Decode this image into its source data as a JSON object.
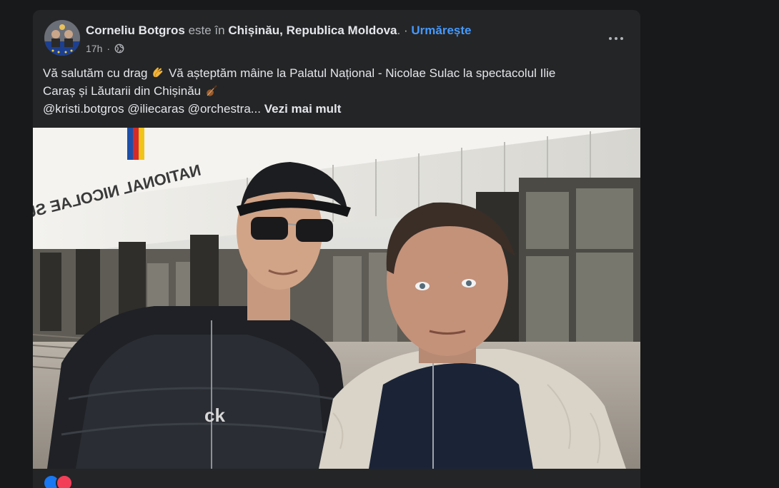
{
  "post": {
    "author": "Corneliu Botgros",
    "connector": "este în",
    "location": "Chișinău, Republica Moldova",
    "dot_after_location": ".",
    "separator": "·",
    "follow_label": "Urmărește",
    "timestamp": "17h",
    "separator2": "·",
    "audience_icon": "globe-icon",
    "menu_icon": "more-options-icon",
    "text_line1_a": "Vă salutăm cu drag",
    "text_line1_b": "Vă așteptăm mâine la Palatul Național  - Nicolae Sulac la spectacolul Ilie",
    "text_line2": "Caraș și Lăutarii  din Chișinău",
    "mentions": "@kristi.botgros @iliecaras @orchestra...",
    "see_more": "Vezi mai mult",
    "photo_sign_text": "NATIONAL NICOLAE SU",
    "photo_jacket_logo": "ck",
    "emoji_1": "clapping-hands-emoji",
    "emoji_2": "violin-emoji"
  },
  "colors": {
    "page_bg": "#18191a",
    "card_bg": "#242526",
    "primary_text": "#e4e6eb",
    "secondary_text": "#b0b3b8",
    "link_blue": "#4599ff"
  }
}
